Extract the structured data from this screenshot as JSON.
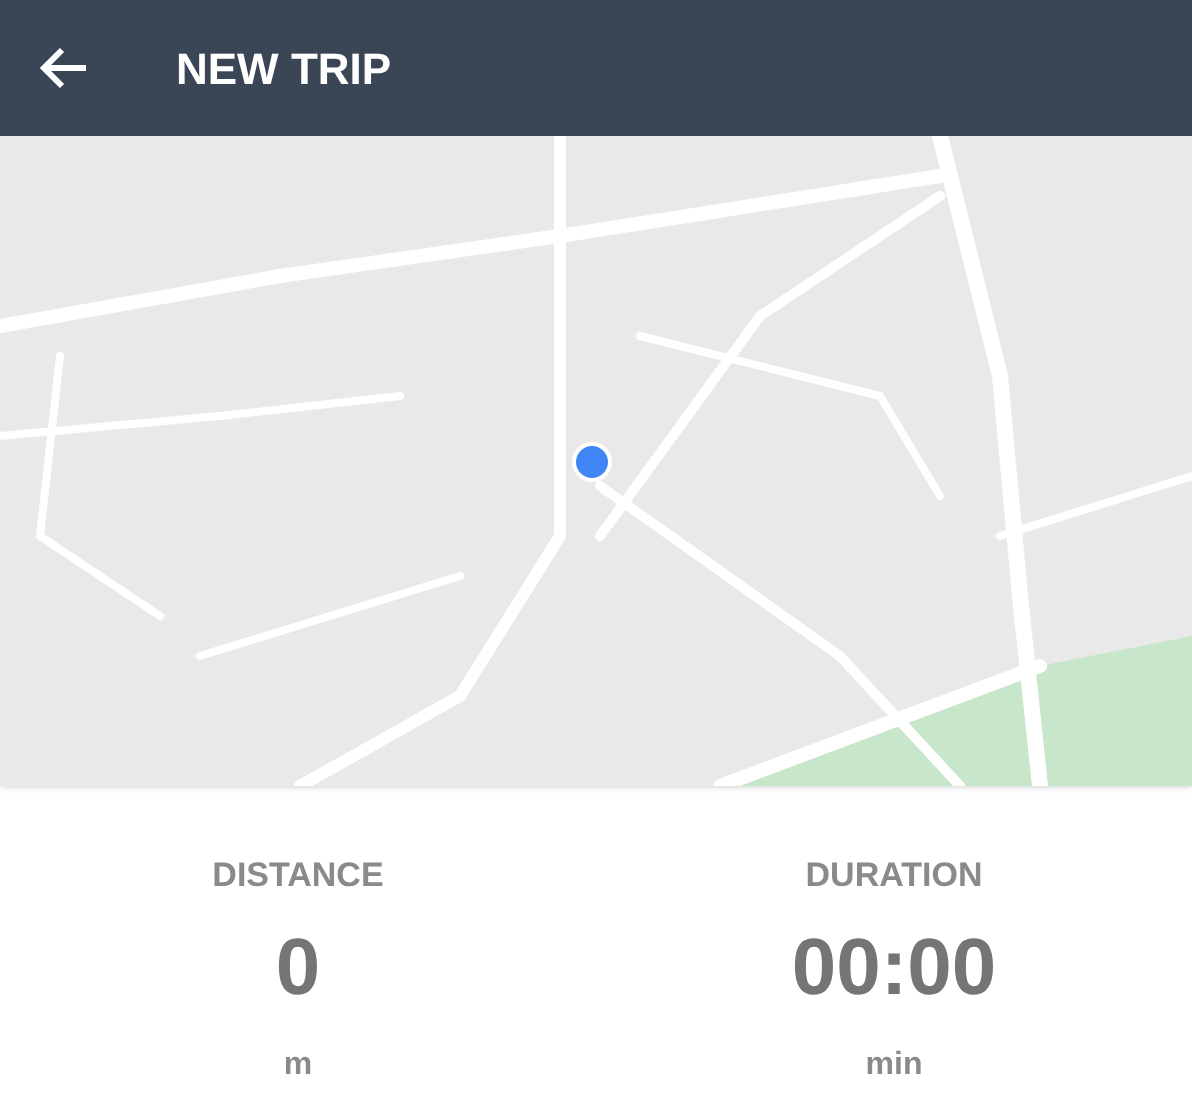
{
  "header": {
    "title": "NEW TRIP"
  },
  "stats": [
    {
      "label": "DISTANCE",
      "value": "0",
      "unit": "m"
    },
    {
      "label": "DURATION",
      "value": "00:00",
      "unit": "min"
    }
  ]
}
